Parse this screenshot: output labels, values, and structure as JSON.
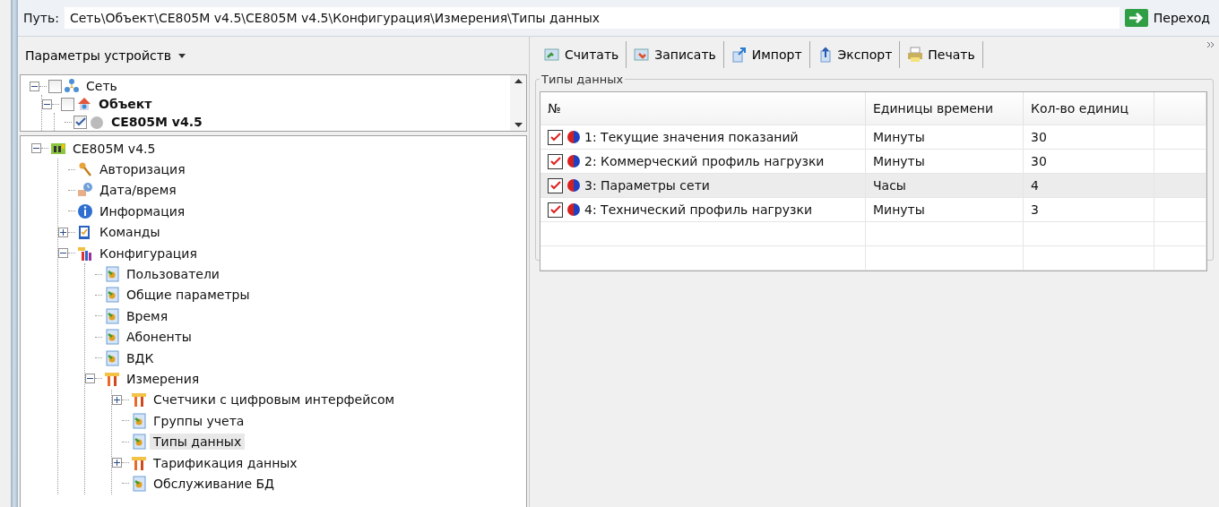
{
  "path_bar": {
    "label": "Путь:",
    "value": "Сеть\\Объект\\CE805M v4.5\\CE805M v4.5\\Конфигурация\\Измерения\\Типы данных",
    "go_button": "Переход"
  },
  "left_panel": {
    "header": "Параметры устройств",
    "top_tree": [
      {
        "label": "Сеть",
        "kind": "network",
        "checked": false,
        "bold": false,
        "expanded": true,
        "children": [
          {
            "label": "Объект",
            "kind": "house",
            "checked": false,
            "bold": true,
            "expanded": true,
            "children": [
              {
                "label": "CE805M v4.5",
                "kind": "sphere",
                "checked": true,
                "bold": true
              }
            ]
          }
        ]
      }
    ],
    "tree": [
      {
        "label": "CE805M v4.5",
        "kind": "device",
        "selected": false,
        "expanded": true,
        "children": [
          {
            "label": "Авторизация",
            "kind": "auth",
            "selected": false
          },
          {
            "label": "Дата/время",
            "kind": "clock",
            "selected": false
          },
          {
            "label": "Информация",
            "kind": "info",
            "selected": false
          },
          {
            "label": "Команды",
            "kind": "commands",
            "selected": false,
            "expanded": false
          },
          {
            "label": "Конфигурация",
            "kind": "config",
            "selected": false,
            "expanded": true,
            "children": [
              {
                "label": "Пользователи",
                "kind": "setting",
                "selected": false
              },
              {
                "label": "Общие параметры",
                "kind": "setting",
                "selected": false
              },
              {
                "label": "Время",
                "kind": "setting",
                "selected": false
              },
              {
                "label": "Абоненты",
                "kind": "setting",
                "selected": false
              },
              {
                "label": "ВДК",
                "kind": "setting",
                "selected": false
              },
              {
                "label": "Измерения",
                "kind": "tools",
                "selected": false,
                "expanded": true,
                "children": [
                  {
                    "label": "Счетчики с цифровым интерфейсом",
                    "kind": "tools",
                    "selected": false,
                    "expanded": false
                  },
                  {
                    "label": "Группы учета",
                    "kind": "setting",
                    "selected": false
                  },
                  {
                    "label": "Типы данных",
                    "kind": "setting",
                    "selected": true
                  },
                  {
                    "label": "Тарификация данных",
                    "kind": "tools",
                    "selected": false,
                    "expanded": false
                  },
                  {
                    "label": "Обслуживание БД",
                    "kind": "setting",
                    "selected": false
                  }
                ]
              }
            ]
          }
        ]
      }
    ]
  },
  "toolbar": [
    {
      "label": "Считать",
      "kind": "read"
    },
    {
      "label": "Записать",
      "kind": "write"
    },
    {
      "label": "Импорт",
      "kind": "import"
    },
    {
      "label": "Экспорт",
      "kind": "export"
    },
    {
      "label": "Печать",
      "kind": "print"
    }
  ],
  "group": {
    "title": "Типы данных",
    "table": {
      "columns": [
        "№",
        "Единицы времени",
        "Кол-во единиц"
      ],
      "rows": [
        {
          "checked": true,
          "selected": false,
          "cells": [
            "1: Текущие значения показаний",
            "Минуты",
            "30"
          ]
        },
        {
          "checked": true,
          "selected": false,
          "cells": [
            "2: Коммерческий профиль нагрузки",
            "Минуты",
            "30"
          ]
        },
        {
          "checked": true,
          "selected": true,
          "cells": [
            "3: Параметры сети",
            "Часы",
            "4"
          ]
        },
        {
          "checked": true,
          "selected": false,
          "cells": [
            "4: Технический профиль нагрузки",
            "Минуты",
            "3"
          ]
        }
      ]
    }
  }
}
